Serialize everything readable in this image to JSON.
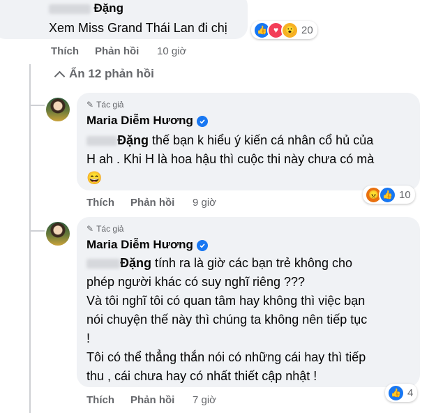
{
  "comment1": {
    "name_suffix": "Đặng",
    "text": "Xem Miss Grand Thái Lan đi chị",
    "reaction_count": "20",
    "reactions": [
      "like-icon",
      "love-icon",
      "wow-icon"
    ]
  },
  "actions": {
    "like": "Thích",
    "reply": "Phản hồi"
  },
  "comment1_time": "10 giờ",
  "hide_replies": "Ẩn 12 phản hồi",
  "reply1": {
    "author_tag": "Tác giả",
    "name": "Maria Diễm Hương",
    "mention": "Đặng",
    "line1": " thế bạn k hiểu ý kiến cá nhân cổ hủ của",
    "line2": "H ah . Khi H là hoa hậu thì cuộc thi này chưa có mà",
    "emoji": "😄",
    "reaction_count": "10",
    "reactions": [
      "angry-icon",
      "like-icon"
    ],
    "time": "9 giờ"
  },
  "reply2": {
    "author_tag": "Tác giả",
    "name": "Maria Diễm Hương",
    "mention": "Đặng",
    "line1": " tính ra là giờ các bạn trẻ không cho",
    "line2": "phép người khác có suy nghĩ riêng ???",
    "line3": "Và tôi nghĩ tôi có quan tâm hay không thì việc bạn",
    "line4": "nói chuyện thế này thì chúng ta không nên tiếp tục",
    "line5": "!",
    "line6": "Tôi có thể thẳng thắn nói có những cái hay thì tiếp",
    "line7": "thu , cái chưa hay có nhất thiết cập nhật !",
    "reaction_count": "4",
    "reactions": [
      "like-icon"
    ],
    "time": "7 giờ"
  },
  "colors": {
    "accent": "#1877f2",
    "secondary_text": "#65676b",
    "bubble": "#f0f2f5"
  }
}
